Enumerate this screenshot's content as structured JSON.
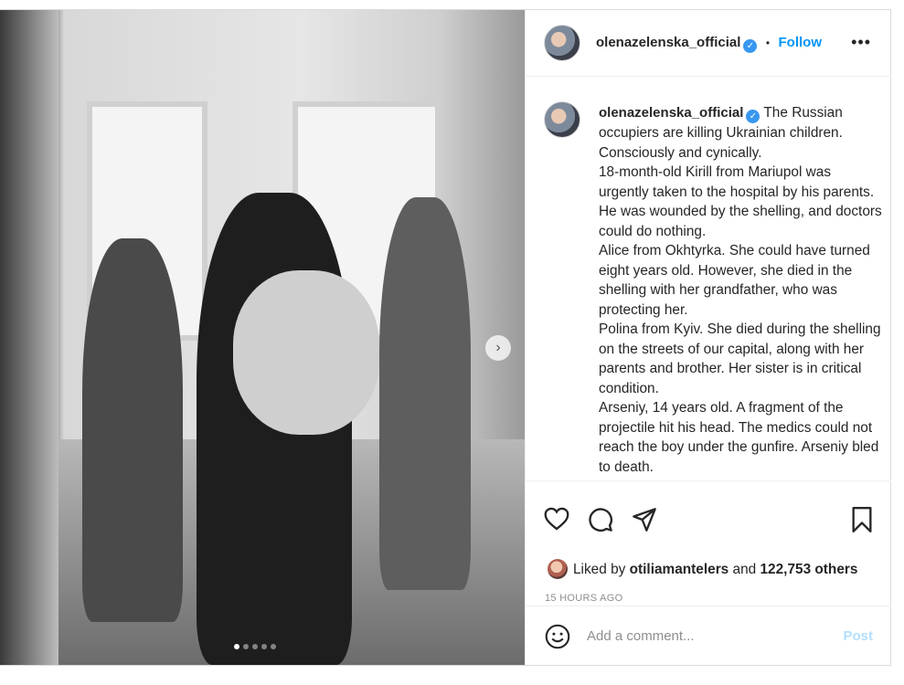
{
  "post": {
    "username": "olenazelenska_official",
    "follow_label": "Follow",
    "more_label": "•••",
    "separator": "•",
    "caption": [
      "The Russian occupiers are killing Ukrainian children. Consciously and cynically.",
      "18-month-old Kirill from Mariupol was urgently taken to the hospital by his parents. He was wounded by the shelling, and doctors could do nothing.",
      "Alice from Okhtyrka. She could have turned eight years old. However, she died in the shelling with her grandfather, who was protecting her.",
      "Polina from Kyiv. She died during the shelling on the streets of our capital, along with her parents and brother. Her sister is in critical condition.",
      "Arseniy, 14 years old. A fragment of the projectile hit his head. The medics could not reach the boy under the gunfire. Arseniy bled to death."
    ],
    "likes": {
      "prefix": "Liked by",
      "user": "otiliamantelers",
      "middle": "and",
      "count": "122,753 others"
    },
    "timestamp": "15 HOURS AGO",
    "comment_placeholder": "Add a comment...",
    "post_button": "Post",
    "carousel": {
      "slides": 5,
      "active_index": 0
    },
    "icons": [
      "heart-icon",
      "comment-icon",
      "share-icon",
      "bookmark-icon",
      "emoji-icon",
      "chevron-right-icon",
      "verified-badge-icon"
    ],
    "colors": {
      "follow": "#0095f6",
      "verified": "#3897f0",
      "post_disabled": "#b2dffc",
      "muted": "#8e8e8e"
    }
  }
}
